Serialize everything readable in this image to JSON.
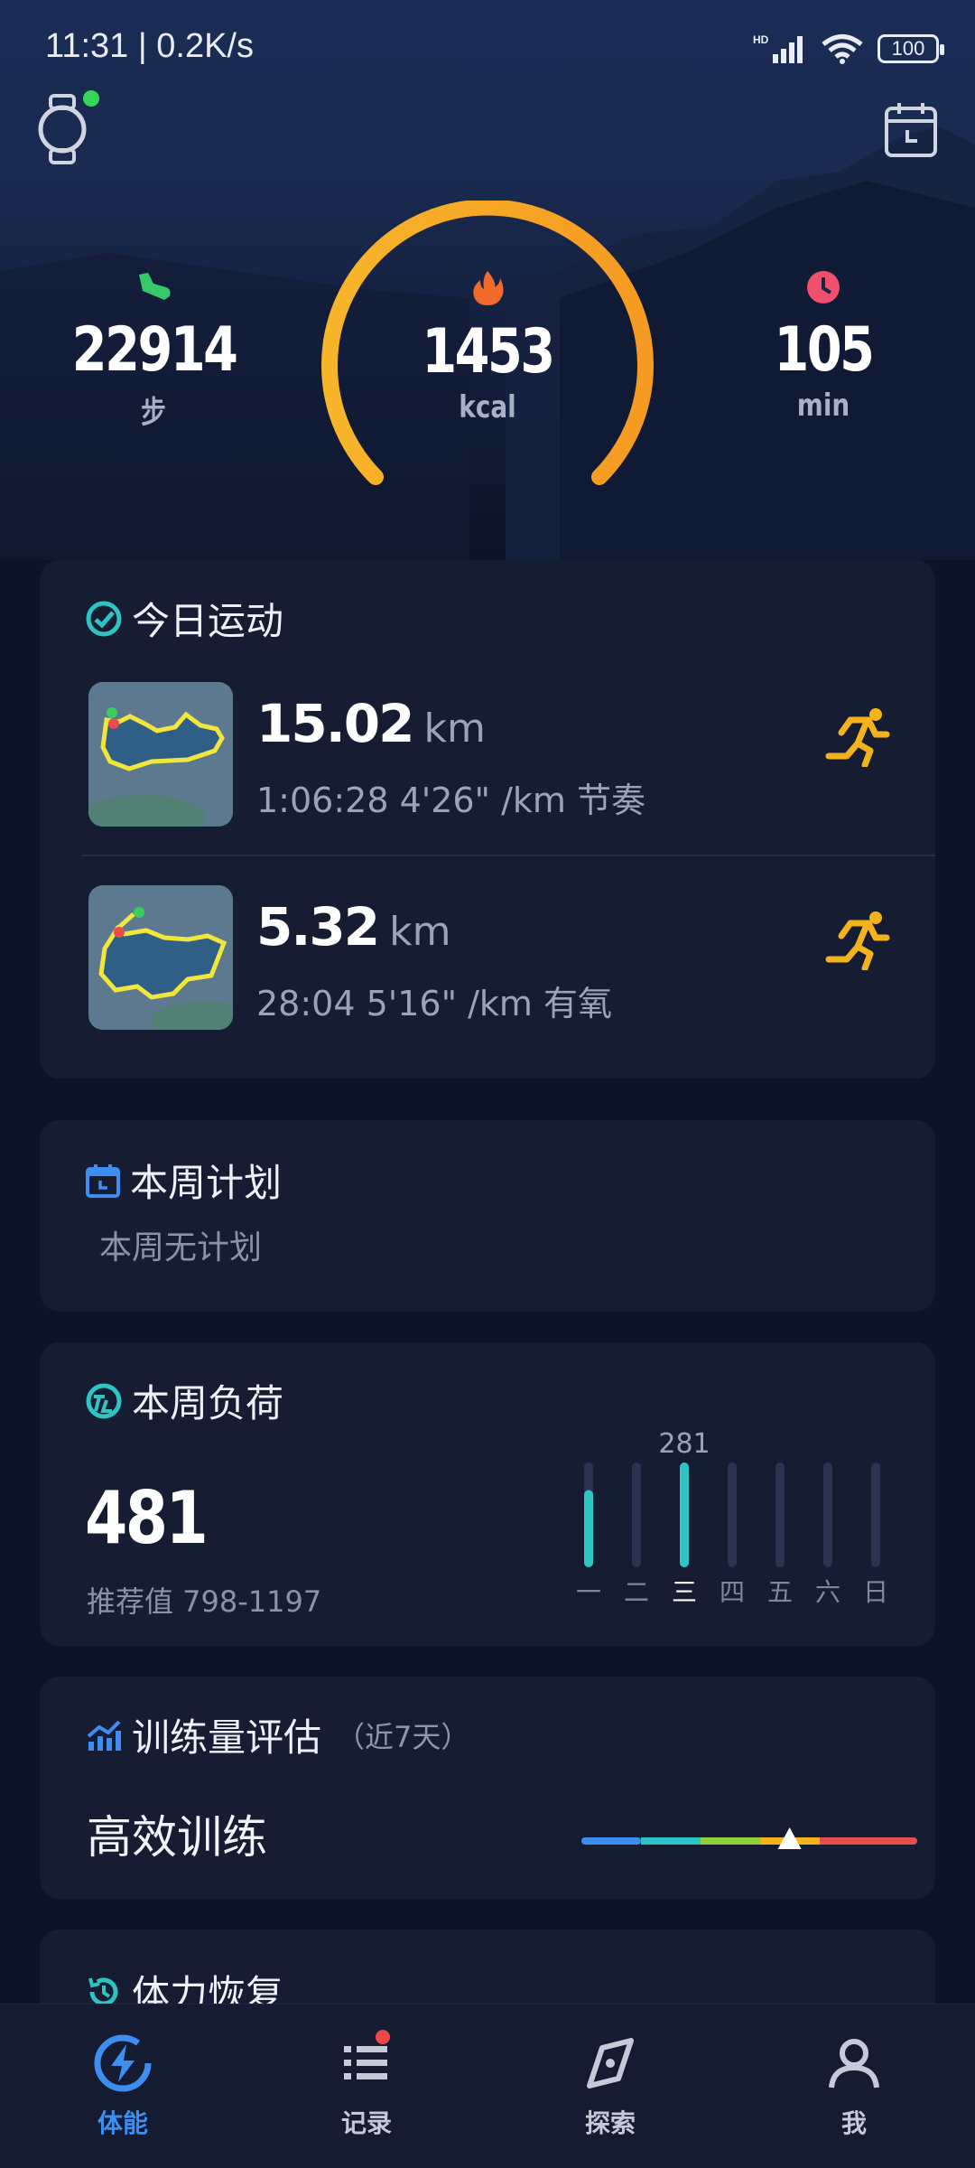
{
  "status_bar": {
    "time": "11:31 | 0.2K/s",
    "battery": "100"
  },
  "summary": {
    "steps": {
      "value": "22914",
      "unit": "步",
      "icon": "shoe-icon"
    },
    "calories": {
      "value": "1453",
      "unit": "kcal",
      "icon": "flame-icon"
    },
    "minutes": {
      "value": "105",
      "unit": "min",
      "icon": "clock-icon"
    }
  },
  "today": {
    "title": "今日运动",
    "runs": [
      {
        "distance": "15.02",
        "unit": "km",
        "detail": "1:06:28  4'26\" /km  节奏"
      },
      {
        "distance": "5.32",
        "unit": "km",
        "detail": "28:04  5'16\" /km  有氧"
      }
    ]
  },
  "plan": {
    "title": "本周计划",
    "empty_text": "本周无计划"
  },
  "load": {
    "title": "本周负荷",
    "value": "481",
    "recommend": "推荐值 798-1197",
    "peak_label": "281",
    "chart_data": {
      "type": "bar",
      "categories": [
        "一",
        "二",
        "三",
        "四",
        "五",
        "六",
        "日"
      ],
      "values": [
        200,
        0,
        281,
        0,
        0,
        0,
        0
      ],
      "ylim": [
        0,
        281
      ]
    }
  },
  "evaluation": {
    "title": "训练量评估",
    "subtitle": "（近7天）",
    "result": "高效训练",
    "position": 0.62
  },
  "recovery": {
    "title": "体力恢复"
  },
  "nav": {
    "items": [
      {
        "label": "体能",
        "icon": "lightning-icon"
      },
      {
        "label": "记录",
        "icon": "list-icon"
      },
      {
        "label": "探索",
        "icon": "compass-icon"
      },
      {
        "label": "我",
        "icon": "person-icon"
      }
    ]
  },
  "colors": {
    "accent": "#3e8ef0",
    "ring": "#f6a623",
    "teal": "#2ec4c4",
    "runner": "#f5b31b"
  }
}
